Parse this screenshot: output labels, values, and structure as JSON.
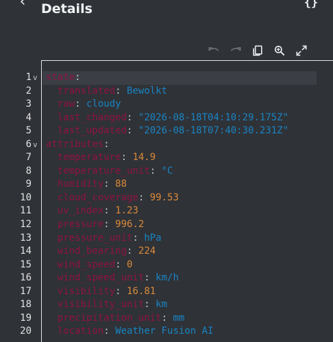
{
  "header": {
    "title": "Details",
    "back_icon": "‹",
    "json_icon": "{}"
  },
  "toolbar": [
    "undo-icon",
    "redo-icon",
    "copy-icon",
    "search-replace-icon",
    "fullscreen-icon"
  ],
  "colors": {
    "key": "#8f1345",
    "string": "#1a84c3",
    "number": "#dc8a39",
    "background": "#2f3237"
  },
  "lines": [
    {
      "n": "1",
      "fold": "v",
      "indent": 0,
      "key": "state",
      "value": "",
      "type": ""
    },
    {
      "n": "2",
      "fold": "",
      "indent": 1,
      "key": "translated",
      "value": "Bewolkt",
      "type": "s"
    },
    {
      "n": "3",
      "fold": "",
      "indent": 1,
      "key": "raw",
      "value": "cloudy",
      "type": "s"
    },
    {
      "n": "4",
      "fold": "",
      "indent": 1,
      "key": "last_changed",
      "value": "\"2026-08-18T04:10:29.175Z\"",
      "type": "s"
    },
    {
      "n": "5",
      "fold": "",
      "indent": 1,
      "key": "last_updated",
      "value": "\"2026-08-18T07:40:30.231Z\"",
      "type": "s"
    },
    {
      "n": "6",
      "fold": "v",
      "indent": 0,
      "key": "attributes",
      "value": "",
      "type": ""
    },
    {
      "n": "7",
      "fold": "",
      "indent": 1,
      "key": "temperature",
      "value": "14.9",
      "type": "n"
    },
    {
      "n": "8",
      "fold": "",
      "indent": 1,
      "key": "temperature_unit",
      "value": "°C",
      "type": "s"
    },
    {
      "n": "9",
      "fold": "",
      "indent": 1,
      "key": "humidity",
      "value": "88",
      "type": "n"
    },
    {
      "n": "10",
      "fold": "",
      "indent": 1,
      "key": "cloud_coverage",
      "value": "99.53",
      "type": "n"
    },
    {
      "n": "11",
      "fold": "",
      "indent": 1,
      "key": "uv_index",
      "value": "1.23",
      "type": "n"
    },
    {
      "n": "12",
      "fold": "",
      "indent": 1,
      "key": "pressure",
      "value": "996.2",
      "type": "n"
    },
    {
      "n": "13",
      "fold": "",
      "indent": 1,
      "key": "pressure_unit",
      "value": "hPa",
      "type": "s"
    },
    {
      "n": "14",
      "fold": "",
      "indent": 1,
      "key": "wind_bearing",
      "value": "224",
      "type": "n"
    },
    {
      "n": "15",
      "fold": "",
      "indent": 1,
      "key": "wind_speed",
      "value": "0",
      "type": "n"
    },
    {
      "n": "16",
      "fold": "",
      "indent": 1,
      "key": "wind_speed_unit",
      "value": "km/h",
      "type": "s"
    },
    {
      "n": "17",
      "fold": "",
      "indent": 1,
      "key": "visibility",
      "value": "16.81",
      "type": "n"
    },
    {
      "n": "18",
      "fold": "",
      "indent": 1,
      "key": "visibility_unit",
      "value": "km",
      "type": "s"
    },
    {
      "n": "19",
      "fold": "",
      "indent": 1,
      "key": "precipitation_unit",
      "value": "mm",
      "type": "s"
    },
    {
      "n": "20",
      "fold": "",
      "indent": 1,
      "key": "location",
      "value": "Weather Fusion AI",
      "type": "s"
    }
  ]
}
